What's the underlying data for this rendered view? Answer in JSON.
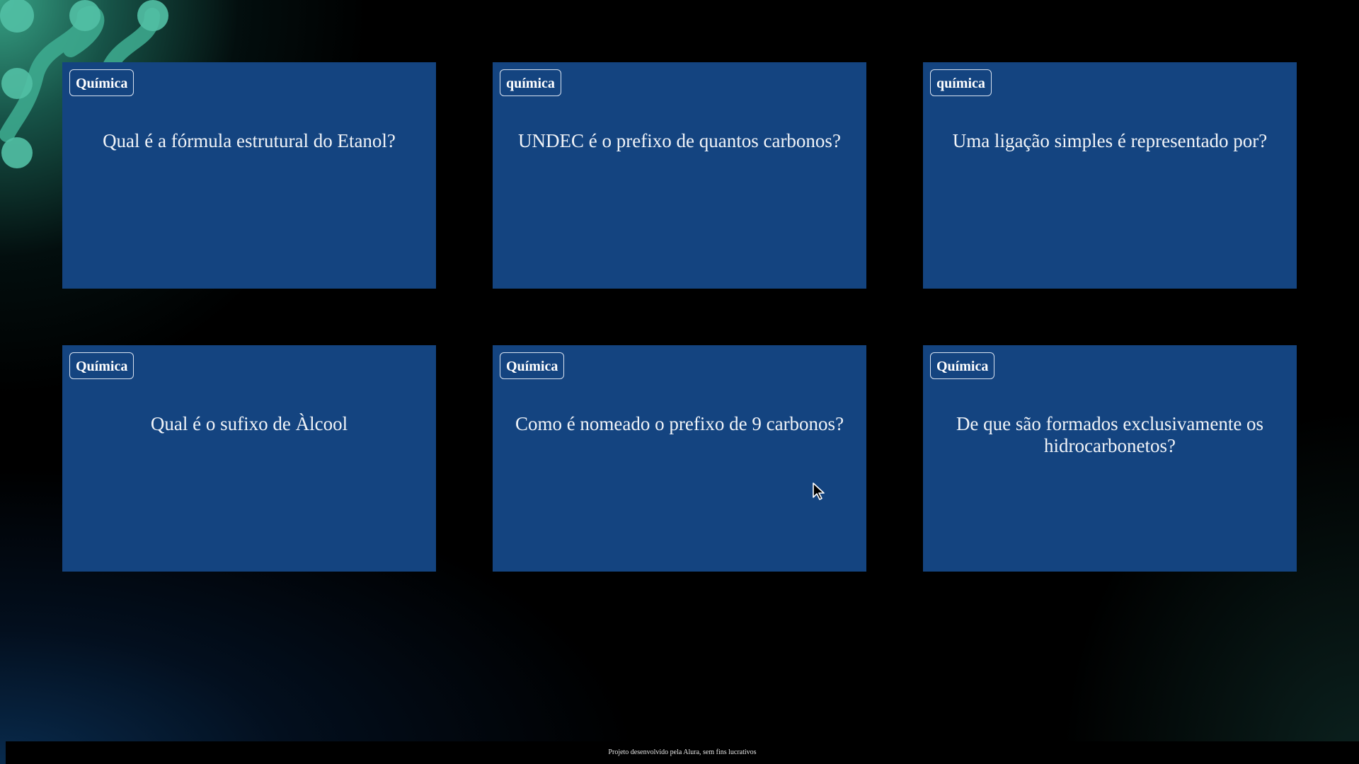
{
  "cards": [
    {
      "tag": "Química",
      "question": "Qual é a fórmula estrutural do Etanol?"
    },
    {
      "tag": "química",
      "question": "UNDEC é o prefixo de quantos carbonos?"
    },
    {
      "tag": "química",
      "question": "Uma ligação simples é representado por?"
    },
    {
      "tag": "Química",
      "question": "Qual é o sufixo de Àlcool"
    },
    {
      "tag": "Química",
      "question": "Como é nomeado o prefixo de 9 carbonos?"
    },
    {
      "tag": "Química",
      "question": "De que são formados exclusivamente os hidrocarbonetos?"
    }
  ],
  "footer": {
    "text": "Projeto desenvolvido pela Alura, sem fins lucrativos"
  },
  "colors": {
    "card_background": "#144480",
    "page_background": "#000000",
    "accent_teal": "#3aaa8c"
  },
  "icons": {
    "decoration": "molecule-decoration-icon",
    "cursor": "mouse-pointer-icon"
  }
}
